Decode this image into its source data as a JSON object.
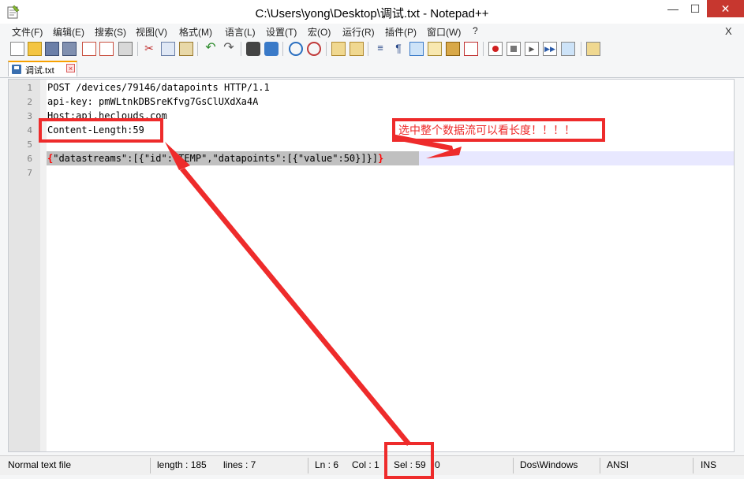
{
  "window": {
    "title": "C:\\Users\\yong\\Desktop\\调试.txt - Notepad++",
    "minimize": "—",
    "maximize": "☐",
    "close": "✕"
  },
  "menu": {
    "items": [
      "文件(F)",
      "编辑(E)",
      "搜索(S)",
      "视图(V)",
      "格式(M)",
      "语言(L)",
      "设置(T)",
      "宏(O)",
      "运行(R)",
      "插件(P)",
      "窗口(W)",
      "?"
    ],
    "close_label": "X"
  },
  "toolbar": {
    "icons": [
      "new-file-icon",
      "open-file-icon",
      "save-icon",
      "save-all-icon",
      "close-icon",
      "close-all-icon",
      "print-icon",
      "cut-icon",
      "copy-icon",
      "paste-icon",
      "undo-icon",
      "redo-icon",
      "find-icon",
      "replace-icon",
      "zoom-in-icon",
      "zoom-out-icon",
      "sync-vertical-icon",
      "sync-horizontal-icon",
      "word-wrap-icon",
      "show-all-chars-icon",
      "indent-guide-icon",
      "user-lang-icon",
      "doc-map-icon",
      "function-list-icon",
      "record-macro-icon",
      "stop-macro-icon",
      "play-macro-icon",
      "run-macro-multiple-icon",
      "save-macro-icon",
      "launch-browser-icon"
    ]
  },
  "tab": {
    "label": "调试.txt",
    "close": "×"
  },
  "editor": {
    "line_numbers": [
      "1",
      "2",
      "3",
      "4",
      "5",
      "6",
      "7"
    ],
    "lines": [
      "POST /devices/79146/datapoints HTTP/1.1",
      "api-key: pmWLtnkDBSreKfvg7GsClUXdXa4A",
      "Host:api.heclouds.com",
      "Content-Length:59",
      "",
      "\"datastreams\":[{\"id\":\"TEMP\",\"datapoints\":[{\"value\":50}]}]",
      ""
    ],
    "brace_open": "{",
    "brace_close": "}",
    "selected_line": 6
  },
  "annotation": {
    "note": "选中整个数据流可以看长度！！！！",
    "color": "#ee2b2b"
  },
  "statusbar": {
    "file_type": "Normal text file",
    "length": "length : 185",
    "lines": "lines : 7",
    "ln": "Ln : 6",
    "col": "Col : 1",
    "sel": "Sel : 59",
    "sel_tail": "0",
    "eol": "Dos\\Windows",
    "encoding": "ANSI",
    "mode": "INS"
  }
}
